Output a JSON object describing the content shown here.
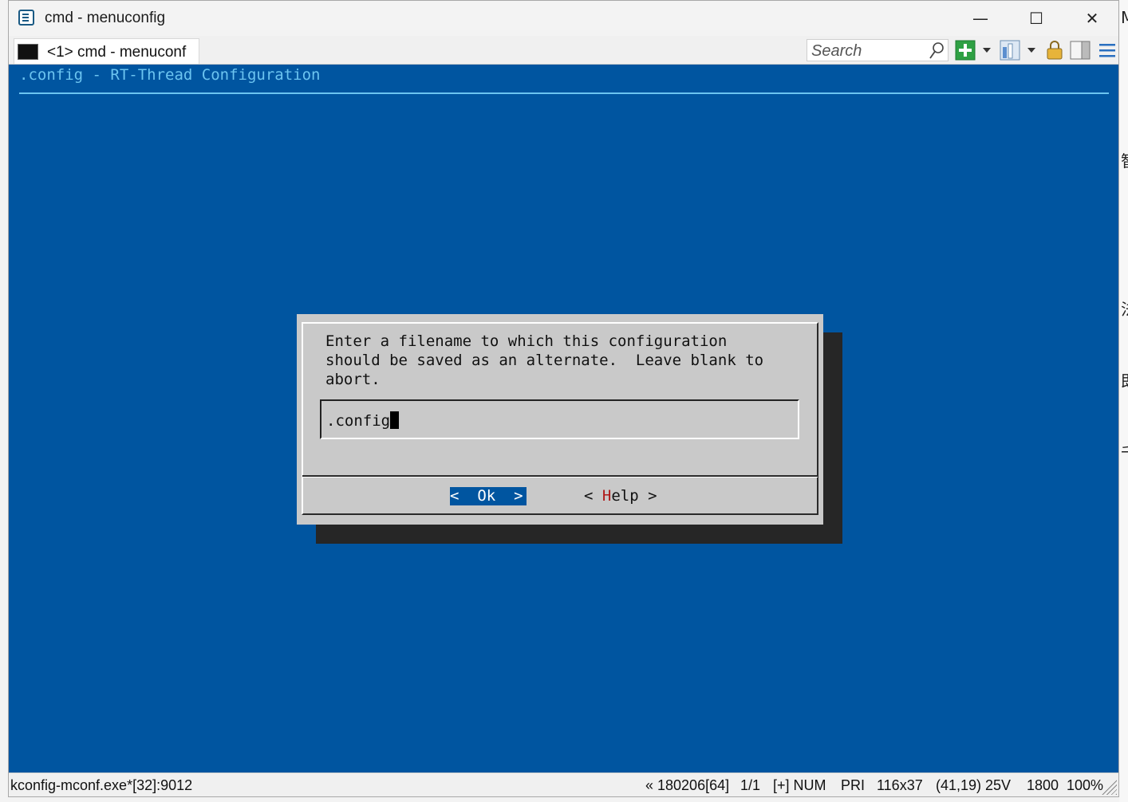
{
  "window": {
    "title": "cmd - menuconfig"
  },
  "controls": {
    "minimize": "—",
    "maximize": "☐",
    "close": "✕"
  },
  "tab": {
    "label": "<1> cmd - menuconf"
  },
  "search": {
    "placeholder": "Search"
  },
  "terminal": {
    "header": ".config - RT-Thread Configuration",
    "dialog": {
      "lines": [
        "Enter a filename to which this configuration",
        "should be saved as an alternate.  Leave blank to",
        "abort."
      ],
      "input_value": ".config",
      "ok_button": {
        "left": "<",
        "label": "Ok",
        "right": ">"
      },
      "help_button": {
        "left": "<",
        "hotkey": "H",
        "rest": "elp",
        "right": ">"
      }
    }
  },
  "statusbar": {
    "process": "kconfig-mconf.exe*[32]:9012",
    "items": [
      "« 180206[64]",
      "1/1",
      "[+] NUM",
      "PRI",
      "116x37",
      "(41,19) 25V",
      "1800",
      "100%"
    ]
  },
  "background_app": {
    "chars": [
      "M",
      "智",
      "法",
      "即",
      "千"
    ]
  },
  "colors": {
    "terminal_bg": "#0055a0",
    "header_fg": "#6cc4f0",
    "dialog_bg": "#c9c9c9",
    "button_selected_bg": "#0055a0",
    "hotkey": "#b01818"
  },
  "icons": [
    "cmd-app-icon",
    "console-tab-icon",
    "search-icon",
    "new-console-icon",
    "view-icon",
    "lock-icon",
    "split-panel-icon",
    "menu-icon"
  ]
}
